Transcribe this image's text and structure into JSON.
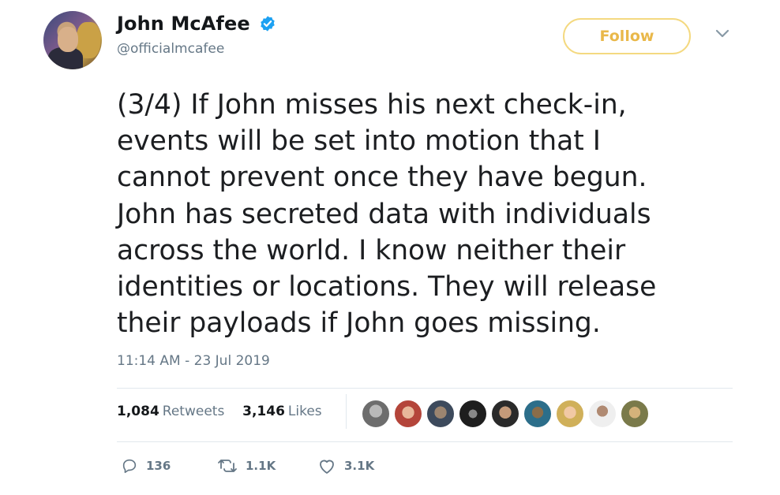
{
  "tweet": {
    "author": {
      "name": "John McAfee",
      "handle": "@officialmcafee",
      "verified": true
    },
    "follow_label": "Follow",
    "text": "(3/4) If John misses his next check-in,\nevents will be set into motion that I\ncannot prevent once they have begun.\nJohn has secreted data with individuals\nacross the world. I know neither their\nidentities or locations. They will release\ntheir payloads if John goes missing.",
    "timestamp": "11:14 AM - 23 Jul 2019",
    "stats": {
      "retweets_count": "1,084",
      "retweets_label": "Retweets",
      "likes_count": "3,146",
      "likes_label": "Likes"
    },
    "actions": {
      "replies": "136",
      "retweets": "1.1K",
      "likes": "3.1K"
    }
  },
  "colors": {
    "follow_border": "#f4d980",
    "follow_text": "#e9b84a",
    "verified_blue": "#1da1f2",
    "muted_text": "#657786"
  },
  "icons": [
    "verified-badge-icon",
    "chevron-down-icon",
    "reply-icon",
    "retweet-icon",
    "like-icon"
  ]
}
